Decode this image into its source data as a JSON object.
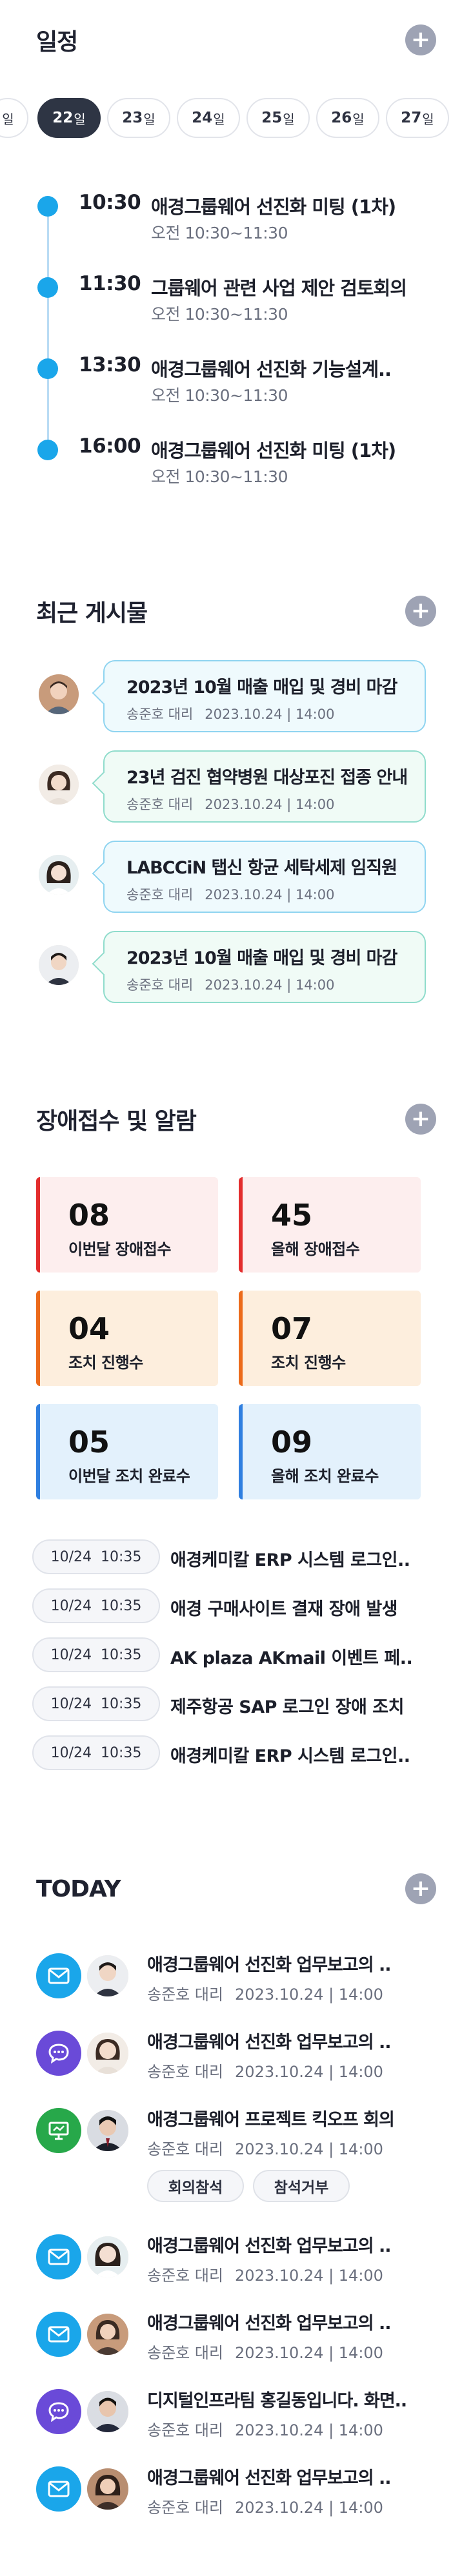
{
  "schedule": {
    "title": "일정",
    "dates": [
      {
        "num": "",
        "unit": "일"
      },
      {
        "num": "22",
        "unit": "일"
      },
      {
        "num": "23",
        "unit": "일"
      },
      {
        "num": "24",
        "unit": "일"
      },
      {
        "num": "25",
        "unit": "일"
      },
      {
        "num": "26",
        "unit": "일"
      },
      {
        "num": "27",
        "unit": "일"
      }
    ],
    "active_date": "22",
    "items": [
      {
        "time": "10:30",
        "title": "애경그룹웨어 선진화 미팅 (1차)",
        "range": "오전 10:30~11:30"
      },
      {
        "time": "11:30",
        "title": "그룹웨어 관련 사업 제안 검토회의",
        "range": "오전 10:30~11:30"
      },
      {
        "time": "13:30",
        "title": "애경그룹웨어 선진화 기능설계..",
        "range": "오전 10:30~11:30"
      },
      {
        "time": "16:00",
        "title": "애경그룹웨어 선진화 미팅 (1차)",
        "range": "오전 10:30~11:30"
      }
    ]
  },
  "posts": {
    "title": "최근 게시물",
    "items": [
      {
        "title": "2023년 10월 매출 매입 및 경비 마감",
        "author": "송준호 대리",
        "date": "2023.10.24 | 14:00"
      },
      {
        "title": "23년 검진 협약병원 대상포진 접종 안내",
        "author": "송준호 대리",
        "date": "2023.10.24 | 14:00"
      },
      {
        "title": "LABCCiN 탭신 항균 세탁세제 임직원",
        "author": "송준호 대리",
        "date": "2023.10.24 | 14:00"
      },
      {
        "title": "2023년 10월 매출 매입 및 경비 마감",
        "author": "송준호 대리",
        "date": "2023.10.24 | 14:00"
      }
    ]
  },
  "faults": {
    "title": "장애접수 및 알람",
    "stats": [
      {
        "value": "08",
        "label": "이번달 장애접수"
      },
      {
        "value": "45",
        "label": "올해 장애접수"
      },
      {
        "value": "04",
        "label": "조치 진행수"
      },
      {
        "value": "07",
        "label": "조치 진행수"
      },
      {
        "value": "05",
        "label": "이번달 조치 완료수"
      },
      {
        "value": "09",
        "label": "올해 조치 완료수"
      }
    ],
    "alarms": [
      {
        "time": "10/24  10:35",
        "text": "애경케미칼 ERP 시스템 로그인.."
      },
      {
        "time": "10/24  10:35",
        "text": "애경 구매사이트 결재 장애 발생"
      },
      {
        "time": "10/24  10:35",
        "text": "AK plaza AKmail 이벤트 페.."
      },
      {
        "time": "10/24  10:35",
        "text": "제주항공 SAP 로그인 장애 조치"
      },
      {
        "time": "10/24  10:35",
        "text": "애경케미칼 ERP 시스템 로그인.."
      }
    ]
  },
  "today": {
    "title": "TODAY",
    "items": [
      {
        "icon": "mail-icon",
        "title": "애경그룹웨어 선진화 업무보고의 ..",
        "author": "송준호 대리",
        "date": "2023.10.24 | 14:00"
      },
      {
        "icon": "chat-icon",
        "title": "애경그룹웨어 선진화 업무보고의 ..",
        "author": "송준호 대리",
        "date": "2023.10.24 | 14:00"
      },
      {
        "icon": "presentation-icon",
        "title": "애경그룹웨어 프로젝트 킥오프 회의",
        "author": "송준호 대리",
        "date": "2023.10.24 | 14:00",
        "actions": [
          "회의참석",
          "참석거부"
        ]
      },
      {
        "icon": "mail-icon",
        "title": "애경그룹웨어 선진화 업무보고의 ..",
        "author": "송준호 대리",
        "date": "2023.10.24 | 14:00"
      },
      {
        "icon": "mail-icon",
        "title": "애경그룹웨어 선진화 업무보고의 ..",
        "author": "송준호 대리",
        "date": "2023.10.24 | 14:00"
      },
      {
        "icon": "chat-icon",
        "title": "디지털인프라팀 홍길동입니다. 화면..",
        "author": "송준호 대리",
        "date": "2023.10.24 | 14:00"
      },
      {
        "icon": "mail-icon",
        "title": "애경그룹웨어 선진화 업무보고의 ..",
        "author": "송준호 대리",
        "date": "2023.10.24 | 14:00"
      }
    ]
  },
  "colors": {
    "accent_blue": "#1aa6ea",
    "active_tab": "#2e3544",
    "alert_red": "#e32d2d",
    "progress_orange": "#ec6a1a",
    "done_blue": "#2f7fe0",
    "chat_purple": "#6a4ad8",
    "meeting_green": "#27a84a"
  }
}
